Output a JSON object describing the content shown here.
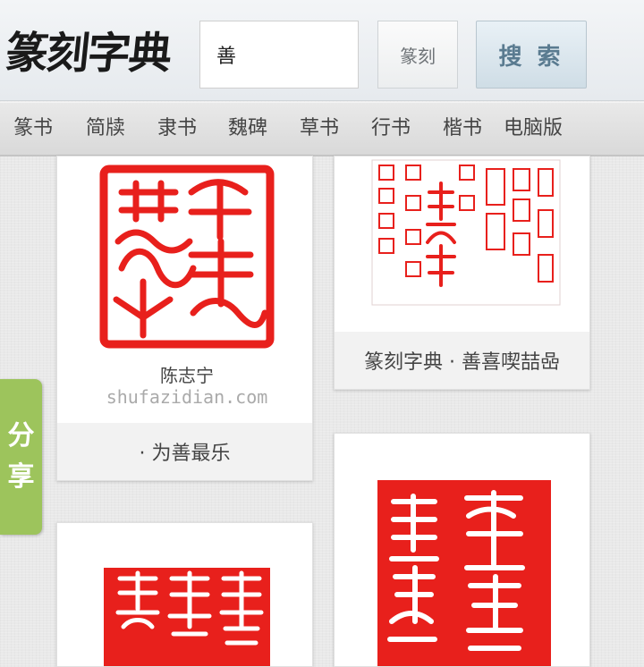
{
  "header": {
    "logo_text": "篆刻字典",
    "search_value": "善",
    "type_select_value": "篆刻",
    "search_button_label": "搜 索"
  },
  "nav": {
    "items": [
      "篆书",
      "简牍",
      "隶书",
      "魏碑",
      "草书",
      "行书",
      "楷书",
      "电脑版"
    ]
  },
  "cards": [
    {
      "caption": "· 为善最乐",
      "image_alt": "为善最乐 seal by 陈志宁",
      "watermark_name": "陈志宁",
      "watermark_site": "shufazidian.com",
      "seal_color": "#e8201c"
    },
    {
      "caption": "篆刻字典 · 善喜喫喆喦",
      "image_alt": "seal chart for 善喜喫喆喦"
    },
    {
      "caption": "",
      "image_alt": "red seal impression"
    },
    {
      "caption": "",
      "image_alt": "red seal impression"
    }
  ],
  "share_tab": {
    "label_top": "分",
    "label_bottom": "享",
    "color": "#9dc45c"
  },
  "colors": {
    "seal_red": "#e8201c",
    "button_text": "#5a7b90"
  }
}
